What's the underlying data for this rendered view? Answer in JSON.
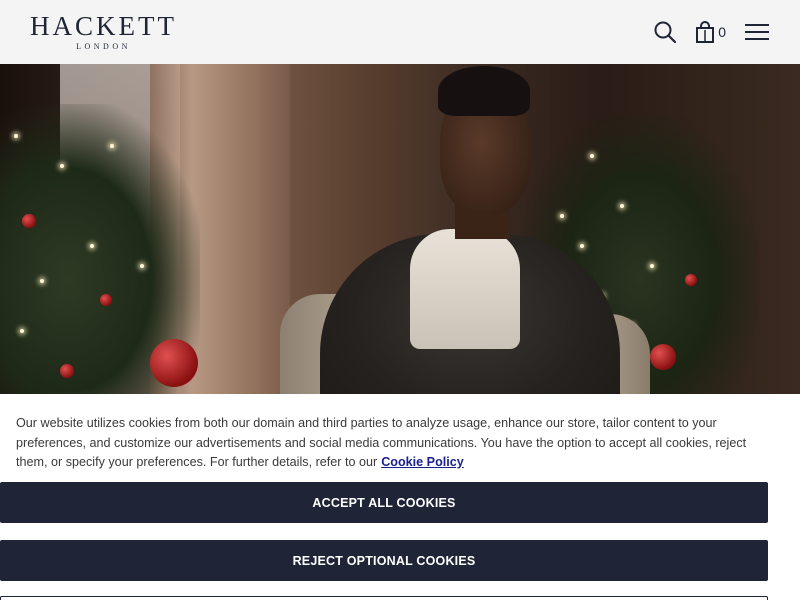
{
  "header": {
    "logo_main": "HACKETT",
    "logo_sub": "LONDON",
    "cart_count": "0",
    "icons": [
      "search-icon",
      "shopping-bag-icon",
      "hamburger-menu-icon"
    ]
  },
  "cookie_banner": {
    "text": "Our website utilizes cookies from both our domain and third parties to analyze usage, enhance our store, tailor content to your preferences, and customize our advertisements and social media communications. You have the option to accept all cookies, reject them, or specify your preferences. For further details, refer to our",
    "link_label": "Cookie Policy",
    "accept_label": "ACCEPT ALL COOKIES",
    "reject_label": "REJECT OPTIONAL COOKIES"
  },
  "colors": {
    "brand_navy": "#1f2436",
    "header_bg": "#f4f4f4",
    "link": "#1a1f8c"
  }
}
